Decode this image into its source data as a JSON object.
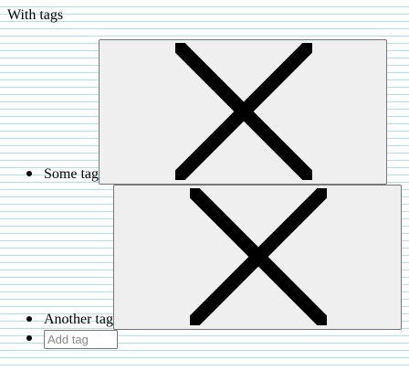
{
  "heading": "With tags",
  "tags": [
    {
      "label": "Some tag",
      "remove_icon": "x-icon"
    },
    {
      "label": "Another tag",
      "remove_icon": "x-icon"
    }
  ],
  "new_tag": {
    "value": "",
    "placeholder": "Add tag"
  },
  "colors": {
    "ruled_line": "#a8e6ee",
    "button_bg": "#efefef",
    "button_border": "#767676"
  }
}
